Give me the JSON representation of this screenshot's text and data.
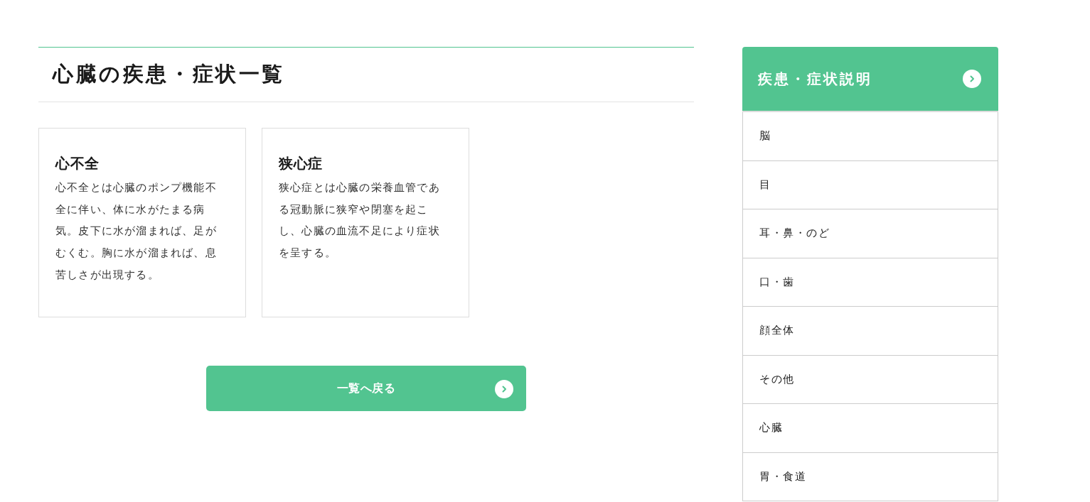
{
  "page_title": "心臓の疾患・症状一覧",
  "cards": [
    {
      "title": "心不全",
      "description": "心不全とは心臓のポンプ機能不全に伴い、体に水がたまる病気。皮下に水が溜まれば、足がむくむ。胸に水が溜まれば、息苦しさが出現する。"
    },
    {
      "title": "狭心症",
      "description": "狭心症とは心臓の栄養血管である冠動脈に狭窄や閉塞を起こし、心臓の血流不足により症状を呈する。"
    }
  ],
  "back_button": {
    "label": "一覧へ戻る"
  },
  "sidebar": {
    "title": "疾患・症状説明",
    "items": [
      {
        "label": "脳"
      },
      {
        "label": "目"
      },
      {
        "label": "耳・鼻・のど"
      },
      {
        "label": "口・歯"
      },
      {
        "label": "顔全体"
      },
      {
        "label": "その他"
      },
      {
        "label": "心臓"
      },
      {
        "label": "胃・食道"
      }
    ]
  }
}
